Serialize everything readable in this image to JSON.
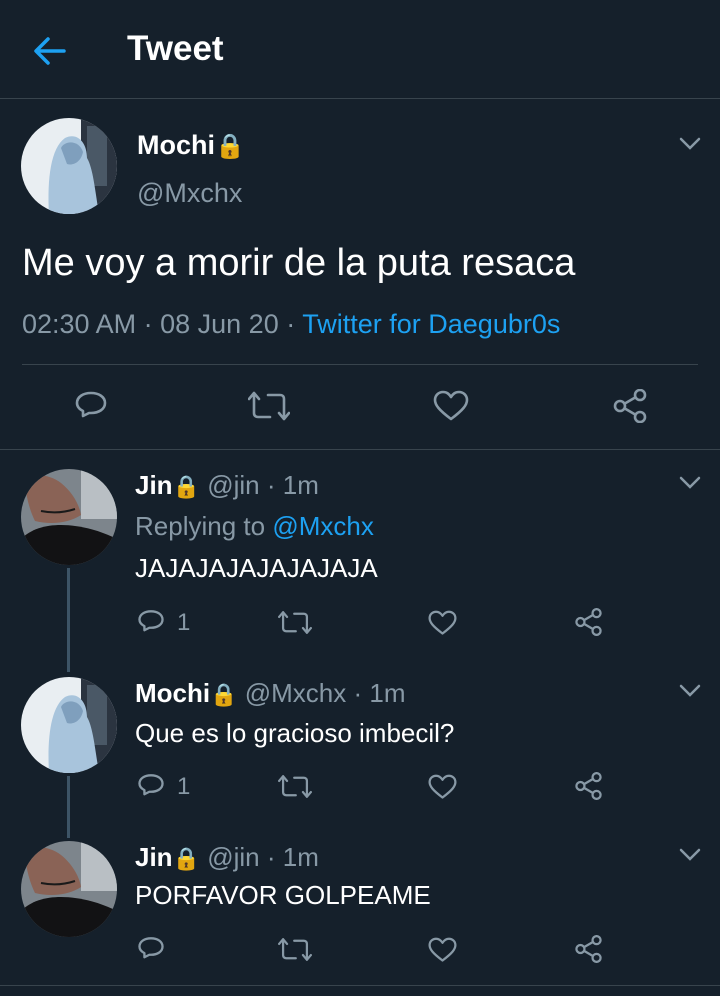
{
  "header": {
    "title": "Tweet",
    "back_icon": "arrow-left-icon"
  },
  "main_tweet": {
    "name": "Mochi",
    "lock": "🔒",
    "handle": "@Mxchx",
    "text": "Me voy a morir de la puta resaca",
    "time": "02:30 AM",
    "date": "08 Jun 20",
    "sep": "·",
    "source": "Twitter for Daegubr0s"
  },
  "replies": [
    {
      "name": "Jin",
      "lock": "🔒",
      "handle": "@jin",
      "time": "· 1m",
      "replying_prefix": "Replying to",
      "replying_handle": "@Mxchx",
      "text": "JAJAJAJAJAJAJAJA",
      "reply_count": "1"
    },
    {
      "name": "Mochi",
      "lock": "🔒",
      "handle": "@Mxchx",
      "time": "· 1m",
      "text": "Que es lo gracioso imbecil?",
      "reply_count": "1"
    },
    {
      "name": "Jin",
      "lock": "🔒",
      "handle": "@jin",
      "time": "· 1m",
      "text": "PORFAVOR GOLPEAME",
      "reply_count": ""
    }
  ],
  "colors": {
    "background": "#15202b",
    "accent": "#1da1f2",
    "muted": "#8899a6",
    "divider": "#38444d",
    "lock": "#f5b400"
  }
}
